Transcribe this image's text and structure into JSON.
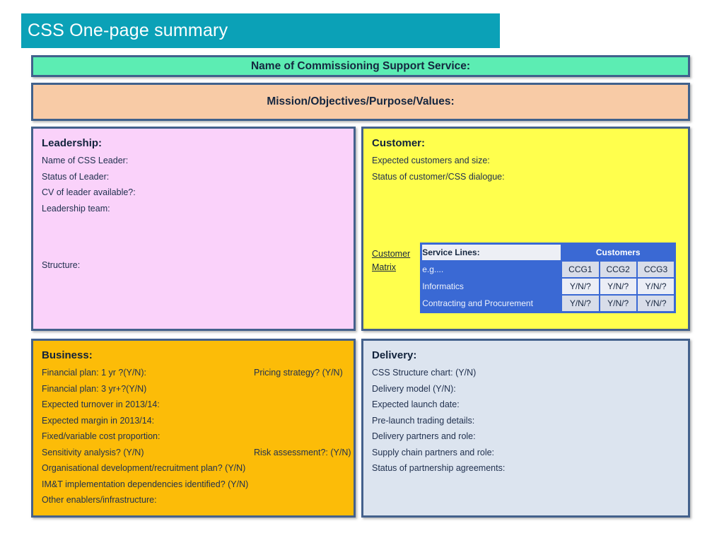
{
  "slide": {
    "title": "CSS One-page summary"
  },
  "banners": {
    "name": "Name of Commissioning Support Service:",
    "mission": "Mission/Objectives/Purpose/Values:"
  },
  "panels": {
    "leadership": {
      "title": "Leadership:",
      "fields": [
        "Name of CSS Leader:",
        "Status of Leader:",
        "CV of leader available?:",
        "Leadership team:"
      ],
      "structure": "Structure:"
    },
    "customer": {
      "title": "Customer:",
      "fields": [
        "Expected customers and size:",
        "Status of customer/CSS dialogue:"
      ],
      "matrix": {
        "label_line1": "Customer",
        "label_line2": "Matrix",
        "table": {
          "col_header": "Service Lines:",
          "group_header": "Customers",
          "rows": [
            {
              "label": "e.g....",
              "cells": [
                "CCG1",
                "CCG2",
                "CCG3"
              ]
            },
            {
              "label": "Informatics",
              "cells": [
                "Y/N/?",
                "Y/N/?",
                "Y/N/?"
              ]
            },
            {
              "label": "Contracting and Procurement",
              "cells": [
                "Y/N/?",
                "Y/N/?",
                "Y/N/?"
              ]
            }
          ]
        }
      }
    },
    "business": {
      "title": "Business:",
      "rows": [
        {
          "left": "Financial plan: 1 yr ?(Y/N):",
          "right": "Pricing strategy? (Y/N)"
        },
        {
          "left": "Financial plan: 3 yr+?(Y/N)"
        },
        {
          "left": "Expected turnover in 2013/14:"
        },
        {
          "left": "Expected margin in 2013/14:"
        },
        {
          "left": "Fixed/variable cost proportion:"
        },
        {
          "left": "Sensitivity analysis? (Y/N)",
          "right": "Risk assessment?:  (Y/N)"
        },
        {
          "left": "Organisational development/recruitment plan? (Y/N)"
        },
        {
          "left": "IM&T implementation dependencies identified? (Y/N)"
        },
        {
          "left": "Other enablers/infrastructure:"
        }
      ]
    },
    "delivery": {
      "title": "Delivery:",
      "fields": [
        "CSS Structure chart: (Y/N)",
        "Delivery model (Y/N):",
        "Expected launch date:",
        "Pre-launch trading details:",
        "Delivery partners and role:",
        "Supply chain partners and role:",
        "Status of partnership agreements:"
      ]
    }
  },
  "colors": {
    "title_bar": "#0ba1b7",
    "name_banner": "#5cedb3",
    "mission_banner": "#f8cba6",
    "leadership_panel": "#fad2fa",
    "customer_panel": "#ffff4d",
    "business_panel": "#fcbc08",
    "delivery_panel": "#dce4ef",
    "panel_border": "#44618c",
    "matrix_blue": "#3a69d4",
    "matrix_cell_gray": "#d8dde9",
    "matrix_cell_light": "#ebeef6",
    "text_dark": "#21314f"
  }
}
